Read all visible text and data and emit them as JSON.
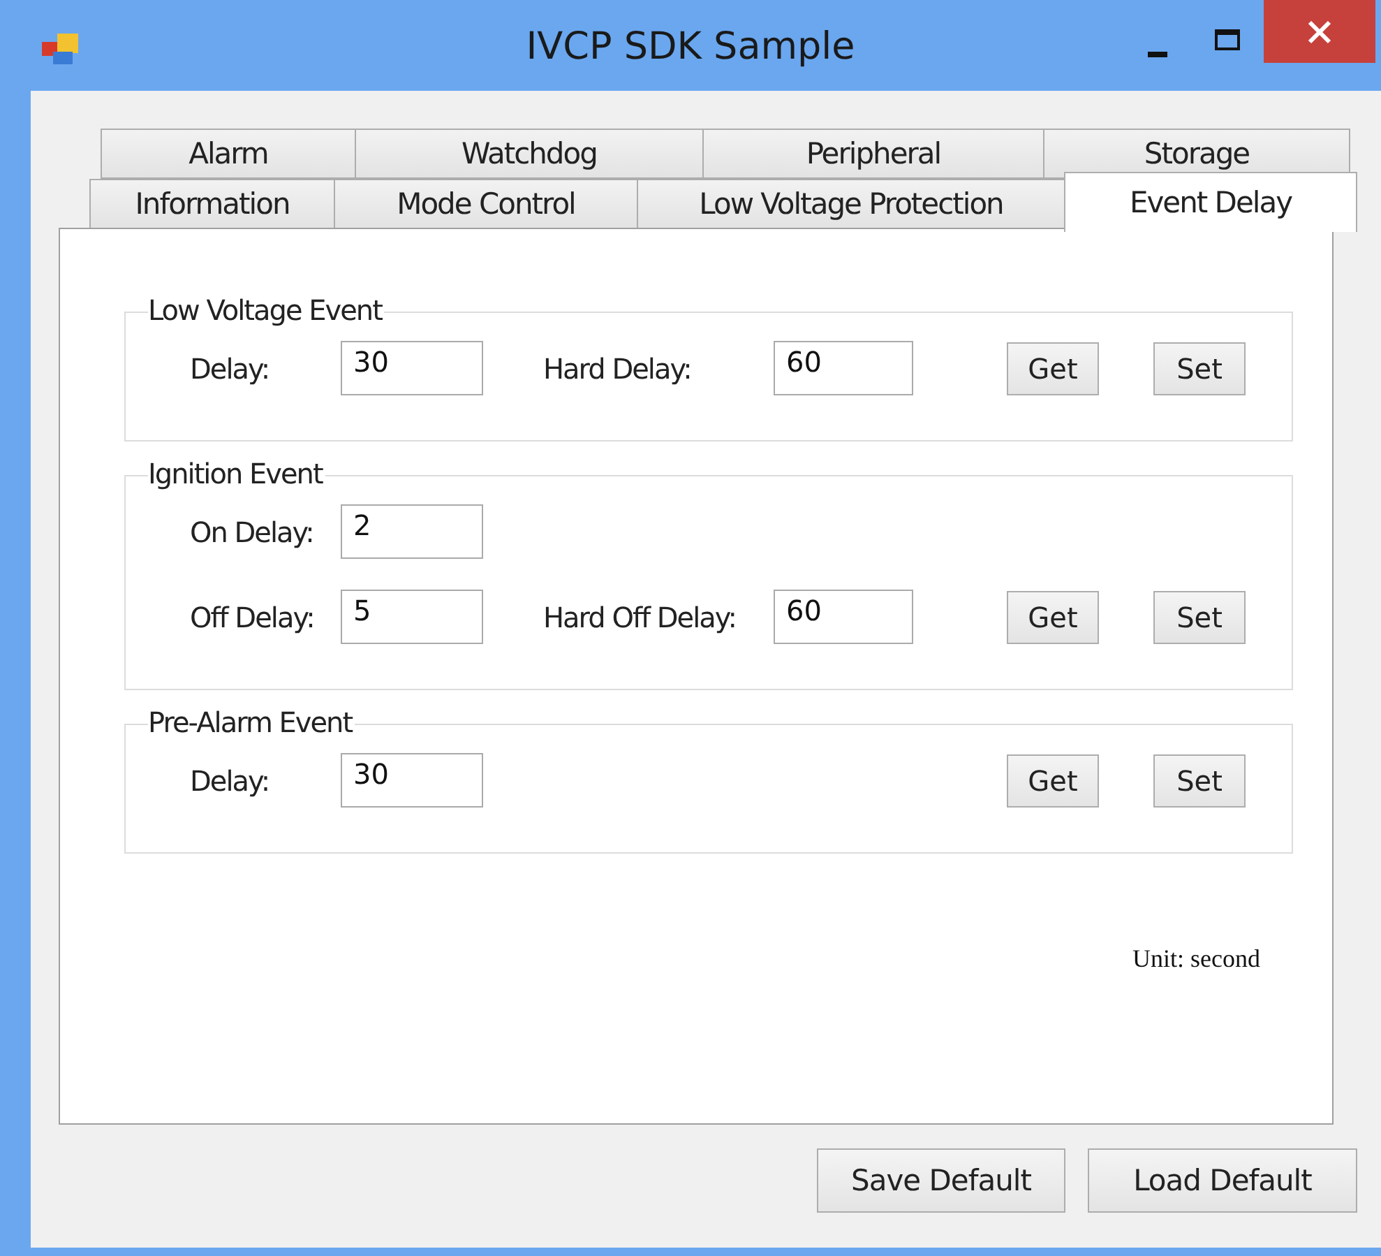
{
  "window": {
    "title": "IVCP SDK Sample"
  },
  "tab_rows": [
    [
      {
        "label": "Alarm",
        "selected": false
      },
      {
        "label": "Watchdog",
        "selected": false
      },
      {
        "label": "Peripheral",
        "selected": false
      },
      {
        "label": "Storage",
        "selected": false
      }
    ],
    [
      {
        "label": "Information",
        "selected": false
      },
      {
        "label": "Mode Control",
        "selected": false
      },
      {
        "label": "Low Voltage Protection",
        "selected": false
      },
      {
        "label": "Event Delay",
        "selected": true
      }
    ]
  ],
  "groups": [
    {
      "title": "Low Voltage Event",
      "rows": [
        {
          "fields": [
            {
              "label": "Delay:",
              "value": "30"
            },
            {
              "label": "Hard Delay:",
              "value": "60"
            }
          ]
        }
      ],
      "buttons": [
        "Get",
        "Set"
      ]
    },
    {
      "title": "Ignition Event",
      "rows": [
        {
          "fields": [
            {
              "label": "On Delay:",
              "value": "2"
            }
          ]
        },
        {
          "fields": [
            {
              "label": "Off Delay:",
              "value": "5"
            },
            {
              "label": "Hard Off Delay:",
              "value": "60"
            }
          ]
        }
      ],
      "buttons": [
        "Get",
        "Set"
      ]
    },
    {
      "title": "Pre-Alarm Event",
      "rows": [
        {
          "fields": [
            {
              "label": "Delay:",
              "value": "30"
            }
          ]
        }
      ],
      "buttons": [
        "Get",
        "Set"
      ]
    }
  ],
  "unit_note": "Unit: second",
  "footer_buttons": [
    "Save Default",
    "Load Default"
  ]
}
